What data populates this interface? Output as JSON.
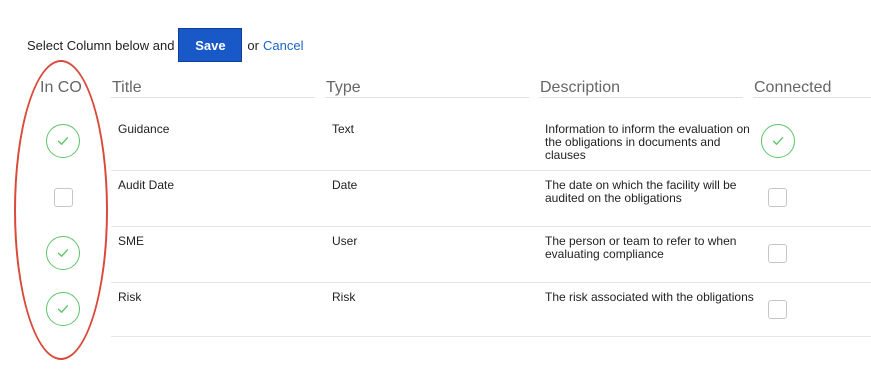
{
  "actionbar": {
    "prompt": "Select Column below and",
    "save_label": "Save",
    "or_text": "or",
    "cancel_label": "Cancel"
  },
  "columns": {
    "in_co": "In CO",
    "title": "Title",
    "type": "Type",
    "description": "Description",
    "connected": "Connected"
  },
  "rows": [
    {
      "title": "Guidance",
      "type": "Text",
      "description": "Information to inform the evaluation on the obligations in documents and clauses",
      "in_co": true,
      "connected": true
    },
    {
      "title": "Audit Date",
      "type": "Date",
      "description": "The date on which the facility will be audited on the obligations",
      "in_co": false,
      "connected": false
    },
    {
      "title": "SME",
      "type": "User",
      "description": "The person or team to refer to when evaluating compliance",
      "in_co": true,
      "connected": false
    },
    {
      "title": "Risk",
      "type": "Risk",
      "description": "The risk associated with the obligations",
      "in_co": true,
      "connected": false
    }
  ],
  "colors": {
    "save_button": "#1858c7",
    "cancel_link": "#1a64c8",
    "check_green": "#5ec46a",
    "annotation_red": "#d94a3a"
  },
  "icons": {
    "checked": "check-icon",
    "unchecked": "empty-checkbox"
  }
}
